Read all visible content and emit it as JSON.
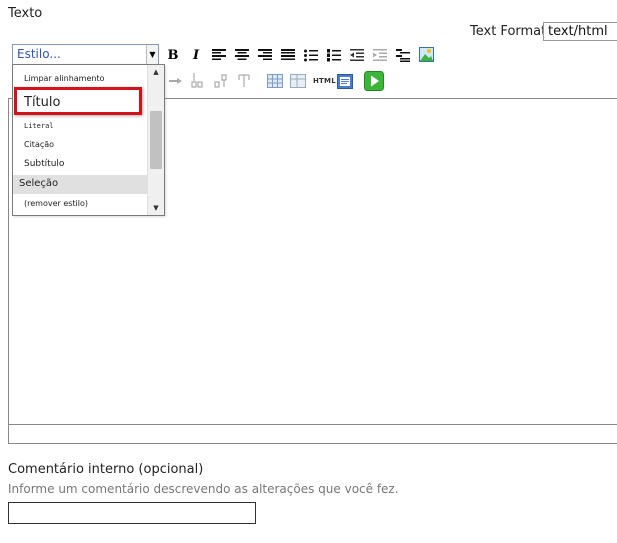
{
  "section_title": "Texto",
  "text_format": {
    "label": "Text Format",
    "value": "text/html"
  },
  "toolbar": {
    "style_placeholder": "Estilo...",
    "bold_label": "B",
    "italic_label": "I",
    "html_label": "HTML"
  },
  "style_dropdown": {
    "items": [
      "Limpar alinhamento",
      "Título",
      "Literal",
      "Citação",
      "Subtítulo",
      "Seleção",
      "(remover estilo)"
    ],
    "highlighted_index": 5,
    "outlined_index": 1
  },
  "comment": {
    "label": "Comentário interno (opcional)",
    "help": "Informe um comentário descrevendo as alterações que você fez.",
    "value": ""
  },
  "colors": {
    "highlight_outline": "#d1121b",
    "style_text": "#3355bb",
    "run_button": "#3cb53a"
  }
}
